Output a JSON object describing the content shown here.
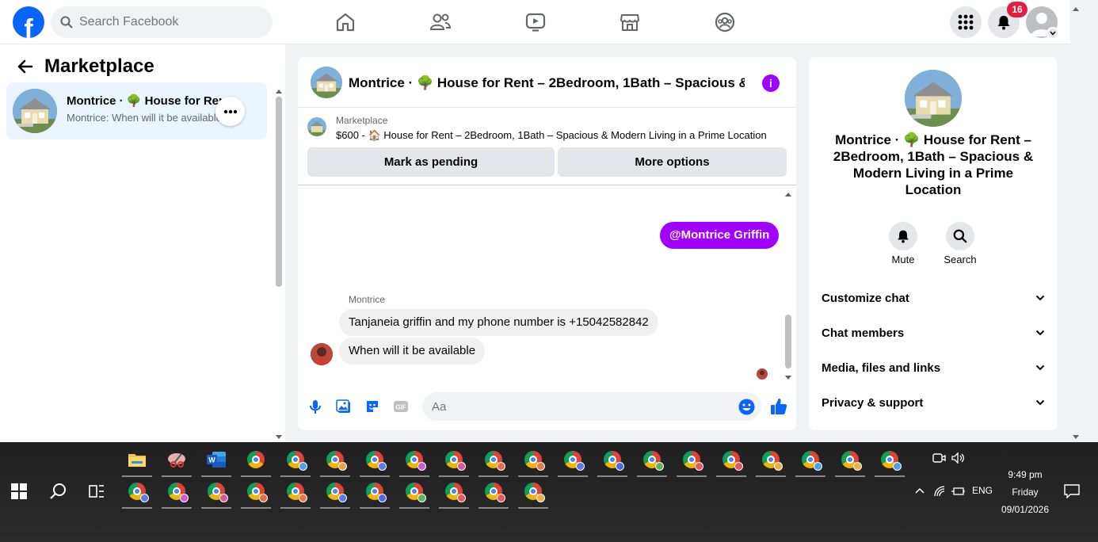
{
  "topbar": {
    "logo": "f",
    "search_placeholder": "Search Facebook",
    "nav_icons": [
      "home-icon",
      "friends-icon",
      "video-icon",
      "marketplace-icon",
      "groups-icon"
    ],
    "notification_count": "16"
  },
  "left": {
    "title": "Marketplace",
    "conversation": {
      "name": "Montrice · 🌳 House for Rent – 2Bedroom, 1Bath – Spacious & Modern Living in a Prime Location",
      "preview": "Montrice: When will it be available"
    }
  },
  "chat": {
    "title": "Montrice · 🌳 House for Rent – 2Bedroom, 1Bath – Spacious & Modern Living in a Prime Location",
    "title_display": "Montrice · 🌳 House for Rent – 2Bedroom, 1Bath – Spacious & ···",
    "banner": {
      "label": "Marketplace",
      "listing": "$600 - 🏠 House for Rent – 2Bedroom, 1Bath – Spacious & Modern Living in a Prime Location",
      "mark_pending": "Mark as pending",
      "more_options": "More options"
    },
    "messages": {
      "outgoing_mention": "@Montrice Griffin",
      "sender": "Montrice",
      "incoming": [
        "Tanjaneia griffin and my phone number is +15042582842",
        "When will it be available"
      ]
    },
    "composer_placeholder": "Aa"
  },
  "right": {
    "title": "Montrice · 🌳 House for Rent – 2Bedroom, 1Bath – Spacious & Modern Living in a Prime Location",
    "mute": "Mute",
    "search": "Search",
    "sections": [
      "Customize chat",
      "Chat members",
      "Media, files and links",
      "Privacy & support"
    ]
  },
  "taskbar": {
    "time": "9:49 pm",
    "day": "Friday",
    "date": "09/01/2026",
    "lang": "ENG"
  },
  "colors": {
    "brand": "#0866ff",
    "accent": "#a100ff",
    "badge": "#e41e3f"
  }
}
